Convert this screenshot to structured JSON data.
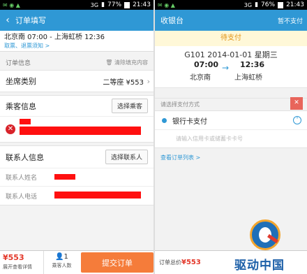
{
  "status_left": {
    "time": "21:43",
    "carrier": "3G",
    "battery": "77%"
  },
  "status_right": {
    "time": "21:43",
    "carrier": "3G",
    "battery": "76%"
  },
  "left": {
    "title": "订单填写",
    "trip": "北京南 07:00 - 上海虹桥 12:36",
    "trip_links": "取票、退票须知 >",
    "order_info_label": "订单信息",
    "clear_label": "清除填充内容",
    "seat_label": "坐席类别",
    "seat_value": "二等座 ¥553",
    "passenger_label": "乘客信息",
    "select_passenger": "选择乘客",
    "contact_label": "联系人信息",
    "select_contact": "选择联系人",
    "contact_name_label": "联系人姓名",
    "contact_phone_label": "联系人电话",
    "price": "¥553",
    "price_sub": "展开查看详情",
    "passenger_count": "1",
    "passenger_count_label": "乘客人数",
    "submit": "提交订单"
  },
  "right": {
    "title": "收银台",
    "not_pay": "暂不支付",
    "pending": "待支付",
    "train_line": "G101  2014-01-01 星期三",
    "dep_time": "07:00",
    "arr_time": "12:36",
    "dep_station": "北京南",
    "arr_station": "上海虹桥",
    "pay_header": "请选择支付方式",
    "bank_pay": "银行卡支付",
    "card_placeholder": "请输入信用卡或储蓄卡卡号",
    "orders_link": "查看订单列表 >",
    "total_label": "订单总价",
    "total_amount": "¥553"
  },
  "watermark": {
    "text": "驱动中国"
  },
  "colors": {
    "accent": "#2f98d5",
    "submit": "#f57c3a",
    "price": "#e3382a",
    "pending_bg": "#fff8d8"
  }
}
